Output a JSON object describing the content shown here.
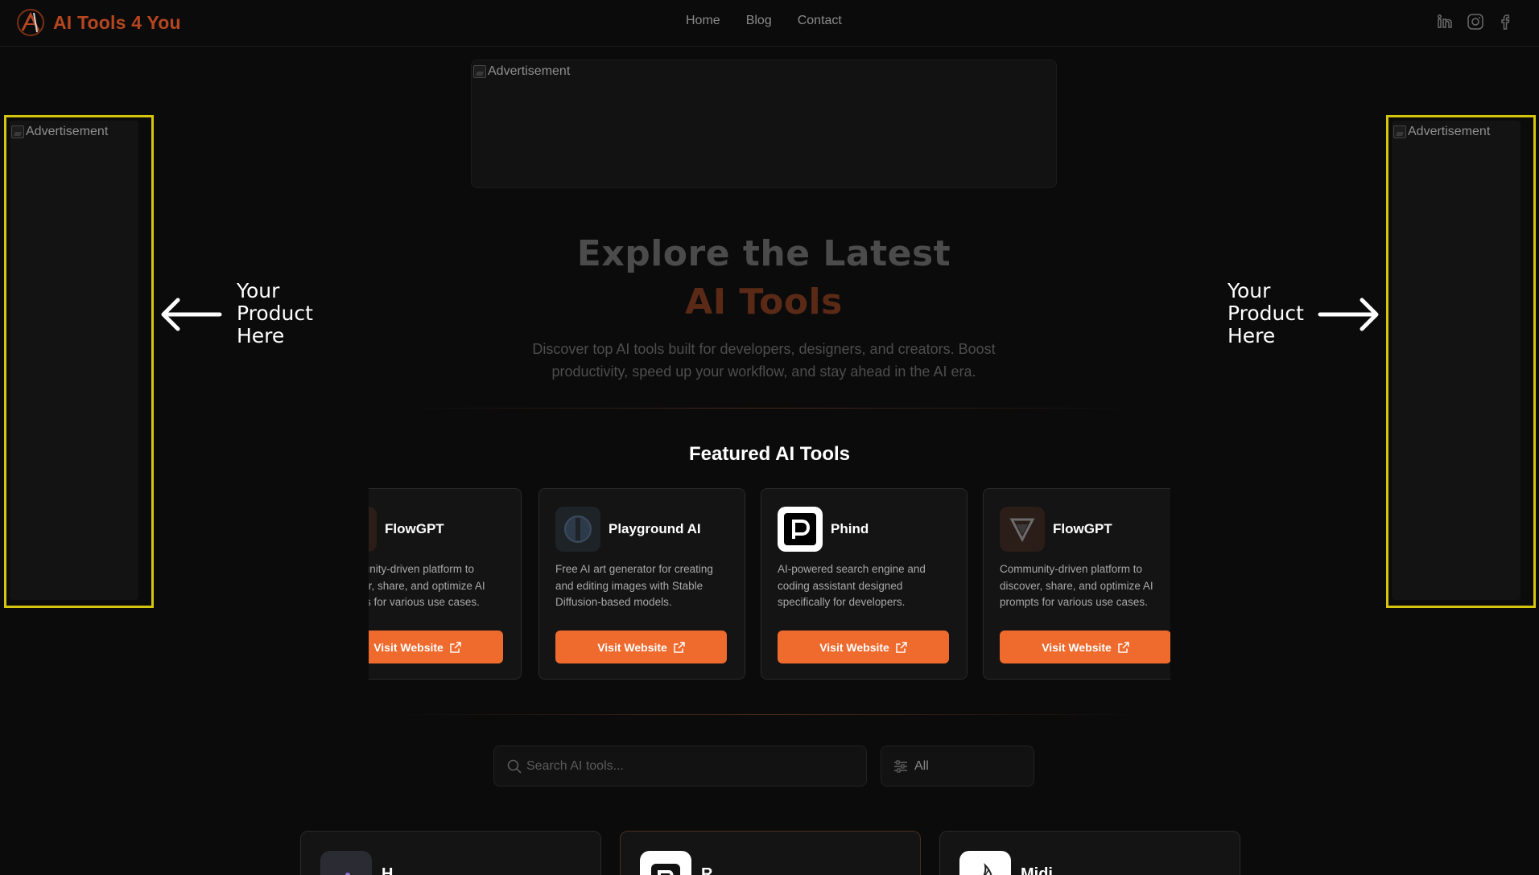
{
  "header": {
    "brand": "AI Tools 4 You",
    "nav": [
      "Home",
      "Blog",
      "Contact"
    ],
    "social_icons": [
      "linkedin-icon",
      "instagram-icon",
      "facebook-icon"
    ]
  },
  "ads": {
    "top": "Advertisement",
    "left": "Advertisement",
    "right": "Advertisement"
  },
  "promo": {
    "left": {
      "line1": "Your",
      "line2": "Product",
      "line3": "Here"
    },
    "right": {
      "line1": "Your",
      "line2": "Product",
      "line3": "Here"
    }
  },
  "hero": {
    "title_line1": "Explore the Latest",
    "title_line2": "AI Tools",
    "subtitle": "Discover top AI tools built for developers, designers, and creators. Boost productivity, speed up your workflow, and stay ahead in the AI era."
  },
  "featured": {
    "title": "Featured AI Tools",
    "button_label": "Visit Website",
    "cards": [
      {
        "name": "FlowGPT",
        "desc": "Community-driven platform to discover, share, and optimize AI prompts for various use cases.",
        "icon": "flowgpt-icon"
      },
      {
        "name": "Playground AI",
        "desc": "Free AI art generator for creating and editing images with Stable Diffusion-based models.",
        "icon": "playground-ai-icon"
      },
      {
        "name": "Phind",
        "desc": "AI-powered search engine and coding assistant designed specifically for developers.",
        "icon": "phind-icon"
      },
      {
        "name": "FlowGPT",
        "desc": "Community-driven platform to discover, share, and optimize AI prompts for various use cases.",
        "icon": "flowgpt-icon"
      }
    ]
  },
  "search": {
    "placeholder": "Search AI tools...",
    "filter_value": "All"
  },
  "grid": {
    "cards": [
      {
        "name": "H",
        "icon": "dots-icon"
      },
      {
        "name": "R",
        "icon": "r-logo-icon"
      },
      {
        "name": "Midj",
        "icon": "sailboat-icon"
      }
    ]
  },
  "colors": {
    "accent": "#ef6a2d",
    "brand": "#b5461f",
    "background": "#0b0b0b",
    "ad_border": "#d6c50e"
  }
}
